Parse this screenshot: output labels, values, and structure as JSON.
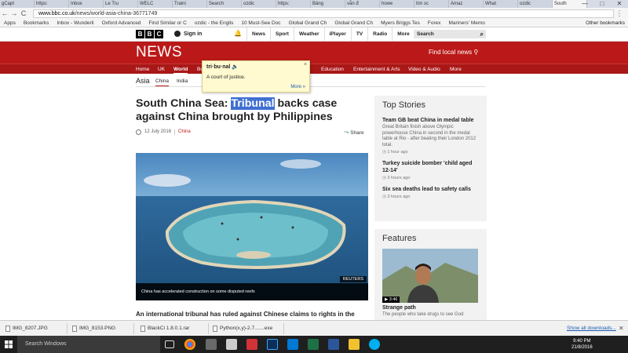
{
  "browser": {
    "tabs": [
      "gCapt",
      "https:",
      "Inbox",
      "Le Tru",
      "WELC",
      "Traini",
      "Search",
      "ozdic",
      "https:",
      "Bảng",
      "vẫn đ",
      "howe",
      "tìm sc",
      "Amaz",
      "What",
      "ozdic",
      "South"
    ],
    "window_controls": [
      "—",
      "□",
      "✕"
    ],
    "nav": {
      "back": "←",
      "forward": "→",
      "reload": "C"
    },
    "url_host": "www.bbc.co.uk",
    "url_path": "/news/world-asia-china-36771749",
    "bookmarks": [
      "Apps",
      "Bookmarks",
      "Inbox - Wunderli",
      "Oxford Advanced",
      "Find Similar or C",
      "ozdic - the Englis",
      "10 Must-See Doc",
      "Global Grand Ch",
      "Global Grand Ch",
      "Myers Briggs Tes",
      "Forex",
      "Mariners' Memo"
    ],
    "other_bookmarks": "Other bookmarks"
  },
  "bbc": {
    "logo": [
      "B",
      "B",
      "C"
    ],
    "signin": "Sign in",
    "topnav": [
      "News",
      "Sport",
      "Weather",
      "iPlayer",
      "TV",
      "Radio",
      "More"
    ],
    "search_label": "Search",
    "news_title": "NEWS",
    "find_local": "Find local news",
    "section_nav": [
      "Home",
      "UK",
      "World",
      "Bu",
      "Education",
      "Entertainment & Arts",
      "Video & Audio",
      "More"
    ],
    "region": "Asia",
    "subnav": [
      "China",
      "India"
    ]
  },
  "tooltip": {
    "term": "tri·bu·nal",
    "definition": "A court of justice.",
    "more": "More »",
    "close": "×"
  },
  "article": {
    "headline_before": "South China Sea: ",
    "headline_highlight": "Tribunal",
    "headline_after": " backs case against China brought by Philippines",
    "date": "12 July 2016",
    "category": "China",
    "share": "Share",
    "image_credit": "REUTERS",
    "caption": "China has accelerated construction on some disputed reefs",
    "lede": "An international tribunal has ruled against Chinese claims to rights in the"
  },
  "top_stories": {
    "title": "Top Stories",
    "items": [
      {
        "title": "Team GB beat China in medal table",
        "summary": "Great Britain finish above Olympic powerhouse China in second in the medal table at Rio - after beating their London 2012 total.",
        "ago": "1 hour ago"
      },
      {
        "title": "Turkey suicide bomber 'child aged 12-14'",
        "summary": "",
        "ago": "3 hours ago"
      },
      {
        "title": "Six sea deaths lead to safety calls",
        "summary": "",
        "ago": "3 hours ago"
      }
    ]
  },
  "features": {
    "title": "Features",
    "duration": "3:46",
    "item_title": "Strange path",
    "item_summary": "The people who take drugs to see God"
  },
  "downloads": {
    "files": [
      "IMG_8207.JPG",
      "IMG_8153.PNG",
      "BlackCi 1.8.0.1.rar",
      "Python(x,y)-2.7.......exe"
    ],
    "show_all": "Show all downloads...",
    "close": "✕"
  },
  "taskbar": {
    "search_placeholder": "Search Windows",
    "time": "9:40 PM",
    "date": "21/8/2016"
  },
  "colors": {
    "bbc_red": "#bb1919",
    "highlight": "#3f6fd1"
  }
}
